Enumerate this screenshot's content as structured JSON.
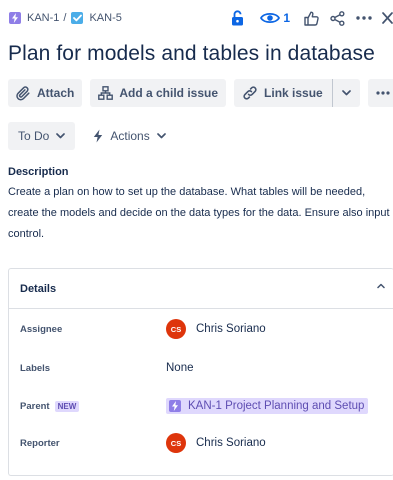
{
  "breadcrumb": {
    "parent_key": "KAN-1",
    "separator": "/",
    "issue_key": "KAN-5"
  },
  "top_actions": {
    "watch_count": "1",
    "icons": [
      "lock-icon",
      "eye-icon",
      "thumbs-up-icon",
      "share-icon",
      "more-icon",
      "close-icon"
    ]
  },
  "issue": {
    "title": "Plan for models and tables in database"
  },
  "toolbar": {
    "attach_label": "Attach",
    "add_child_label": "Add a child issue",
    "link_issue_label": "Link issue"
  },
  "status": {
    "current": "To Do",
    "actions_label": "Actions"
  },
  "description": {
    "heading": "Description",
    "text": "Create a plan on how to set up the database. What tables will be needed, create the models and decide on the data types for the data. Ensure also input control."
  },
  "details": {
    "heading": "Details",
    "assignee_label": "Assignee",
    "assignee_initials": "CS",
    "assignee_name": "Chris Soriano",
    "labels_label": "Labels",
    "labels_value": "None",
    "parent_label": "Parent",
    "parent_badge": "NEW",
    "parent_value": "KAN-1 Project Planning and Setup",
    "reporter_label": "Reporter",
    "reporter_initials": "CS",
    "reporter_name": "Chris Soriano"
  },
  "colors": {
    "epic": "#8f7ee7",
    "task": "#4bade8",
    "link": "#0c66e4",
    "avatar": "#de350b",
    "parent_chip_bg": "#dfd8fd"
  }
}
